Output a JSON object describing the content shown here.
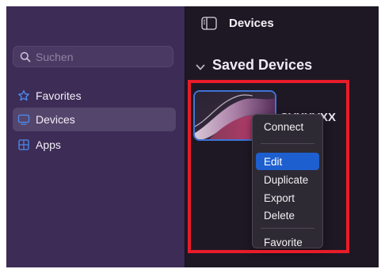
{
  "sidebar": {
    "search": {
      "value": "",
      "placeholder": "Suchen"
    },
    "items": [
      {
        "label": "Favorites",
        "icon": "star-icon",
        "selected": false
      },
      {
        "label": "Devices",
        "icon": "monitor-icon",
        "selected": true
      },
      {
        "label": "Apps",
        "icon": "apps-grid-icon",
        "selected": false
      }
    ]
  },
  "toolbar": {
    "sidebar_toggle_icon": "sidebar-toggle-icon",
    "title": "Devices"
  },
  "section": {
    "title": "Saved Devices",
    "chevron_icon": "chevron-down-icon"
  },
  "device": {
    "name": "SVXXVXX",
    "thumbnail": "wallpaper-thumbnail"
  },
  "context_menu": {
    "items": {
      "connect": "Connect",
      "edit": "Edit",
      "duplicate": "Duplicate",
      "export": "Export",
      "delete": "Delete",
      "favorite": "Favorite"
    },
    "active_item": "Edit"
  },
  "colors": {
    "sidebar_bg": "#3d2c56",
    "main_bg": "#1e1824",
    "accent": "#3f73d6",
    "menu_highlight": "#1e5fcf",
    "annotation_border": "#e81c2a"
  }
}
